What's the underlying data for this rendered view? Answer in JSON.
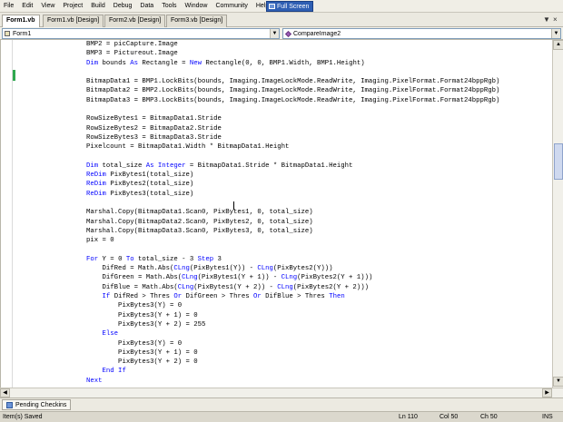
{
  "menu": [
    "File",
    "Edit",
    "View",
    "Project",
    "Build",
    "Debug",
    "Data",
    "Tools",
    "Window",
    "Community",
    "Help"
  ],
  "full_screen_label": "Full Screen",
  "tabs": [
    "Form1.vb",
    "Form1.vb [Design]",
    "Form2.vb [Design]",
    "Form3.vb [Design]"
  ],
  "tab_controls": [
    "▼",
    "×"
  ],
  "class_dropdown": "Form1",
  "method_dropdown": "CompareImage2",
  "code_lines": [
    [
      {
        "t": "        BMP2 = picCapture.Image"
      }
    ],
    [
      {
        "t": "        BMP3 = Pictureout.Image"
      }
    ],
    [
      {
        "t": "        "
      },
      {
        "t": "Dim",
        "k": 1
      },
      {
        "t": " bounds "
      },
      {
        "t": "As",
        "k": 1
      },
      {
        "t": " Rectangle = "
      },
      {
        "t": "New",
        "k": 1
      },
      {
        "t": " Rectangle(0, 0, BMP1.Width, BMP1.Height)"
      }
    ],
    [
      {
        "t": ""
      }
    ],
    [
      {
        "t": "        BitmapData1 = BMP1.LockBits(bounds, Imaging.ImageLockMode.ReadWrite, Imaging.PixelFormat.Format24bppRgb)"
      }
    ],
    [
      {
        "t": "        BitmapData2 = BMP2.LockBits(bounds, Imaging.ImageLockMode.ReadWrite, Imaging.PixelFormat.Format24bppRgb)"
      }
    ],
    [
      {
        "t": "        BitmapData3 = BMP3.LockBits(bounds, Imaging.ImageLockMode.ReadWrite, Imaging.PixelFormat.Format24bppRgb)"
      }
    ],
    [
      {
        "t": ""
      }
    ],
    [
      {
        "t": "        RowSizeBytes1 = BitmapData1.Stride"
      }
    ],
    [
      {
        "t": "        RowSizeBytes2 = BitmapData2.Stride"
      }
    ],
    [
      {
        "t": "        RowSizeBytes3 = BitmapData3.Stride"
      }
    ],
    [
      {
        "t": "        Pixelcount = BitmapData1.Width * BitmapData1.Height"
      }
    ],
    [
      {
        "t": ""
      }
    ],
    [
      {
        "t": "        "
      },
      {
        "t": "Dim",
        "k": 1
      },
      {
        "t": " total_size "
      },
      {
        "t": "As",
        "k": 1
      },
      {
        "t": " "
      },
      {
        "t": "Integer",
        "k": 1
      },
      {
        "t": " = BitmapData1.Stride * BitmapData1.Height"
      }
    ],
    [
      {
        "t": "        "
      },
      {
        "t": "ReDim",
        "k": 1
      },
      {
        "t": " PixBytes1(total_size)"
      }
    ],
    [
      {
        "t": "        "
      },
      {
        "t": "ReDim",
        "k": 1
      },
      {
        "t": " PixBytes2(total_size)"
      }
    ],
    [
      {
        "t": "        "
      },
      {
        "t": "ReDim",
        "k": 1
      },
      {
        "t": " PixBytes3(total_size)"
      }
    ],
    [
      {
        "t": ""
      }
    ],
    [
      {
        "t": "        Marshal.Copy(BitmapData1.Scan0, PixBytes1, 0, total_size)"
      }
    ],
    [
      {
        "t": "        Marshal.Copy(BitmapData2.Scan0, PixBytes2, 0, total_size)"
      }
    ],
    [
      {
        "t": "        Marshal.Copy(BitmapData3.Scan0, PixBytes3, 0, total_size)"
      }
    ],
    [
      {
        "t": "        pix = 0"
      }
    ],
    [
      {
        "t": ""
      }
    ],
    [
      {
        "t": "        "
      },
      {
        "t": "For",
        "k": 1
      },
      {
        "t": " Y = 0 "
      },
      {
        "t": "To",
        "k": 1
      },
      {
        "t": " total_size - 3 "
      },
      {
        "t": "Step",
        "k": 1
      },
      {
        "t": " 3"
      }
    ],
    [
      {
        "t": "            DifRed = Math.Abs("
      },
      {
        "t": "CLng",
        "k": 1
      },
      {
        "t": "(PixBytes1(Y)) - "
      },
      {
        "t": "CLng",
        "k": 1
      },
      {
        "t": "(PixBytes2(Y)))"
      }
    ],
    [
      {
        "t": "            DifGreen = Math.Abs("
      },
      {
        "t": "CLng",
        "k": 1
      },
      {
        "t": "(PixBytes1(Y + 1)) - "
      },
      {
        "t": "CLng",
        "k": 1
      },
      {
        "t": "(PixBytes2(Y + 1)))"
      }
    ],
    [
      {
        "t": "            DifBlue = Math.Abs("
      },
      {
        "t": "CLng",
        "k": 1
      },
      {
        "t": "(PixBytes1(Y + 2)) - "
      },
      {
        "t": "CLng",
        "k": 1
      },
      {
        "t": "(PixBytes2(Y + 2)))"
      }
    ],
    [
      {
        "t": "            "
      },
      {
        "t": "If",
        "k": 1
      },
      {
        "t": " DifRed > Thres "
      },
      {
        "t": "Or",
        "k": 1
      },
      {
        "t": " DifGreen > Thres "
      },
      {
        "t": "Or",
        "k": 1
      },
      {
        "t": " DifBlue > Thres "
      },
      {
        "t": "Then",
        "k": 1
      }
    ],
    [
      {
        "t": "                PixBytes3(Y) = 0"
      }
    ],
    [
      {
        "t": "                PixBytes3(Y + 1) = 0"
      }
    ],
    [
      {
        "t": "                PixBytes3(Y + 2) = 255"
      }
    ],
    [
      {
        "t": "            "
      },
      {
        "t": "Else",
        "k": 1
      }
    ],
    [
      {
        "t": "                PixBytes3(Y) = 0"
      }
    ],
    [
      {
        "t": "                PixBytes3(Y + 1) = 0"
      }
    ],
    [
      {
        "t": "                PixBytes3(Y + 2) = 0"
      }
    ],
    [
      {
        "t": "            "
      },
      {
        "t": "End If",
        "k": 1
      }
    ],
    [
      {
        "t": "        "
      },
      {
        "t": "Next",
        "k": 1
      }
    ]
  ],
  "pending_checkins_label": "Pending Checkins",
  "status": {
    "message": "Item(s) Saved",
    "line": "Ln 110",
    "col": "Col 50",
    "ch": "Ch 50",
    "mode": "INS"
  },
  "colors": {
    "keyword": "#0000ff",
    "active_button": "#2f5fb3",
    "change_bar": "#2fa84f"
  }
}
